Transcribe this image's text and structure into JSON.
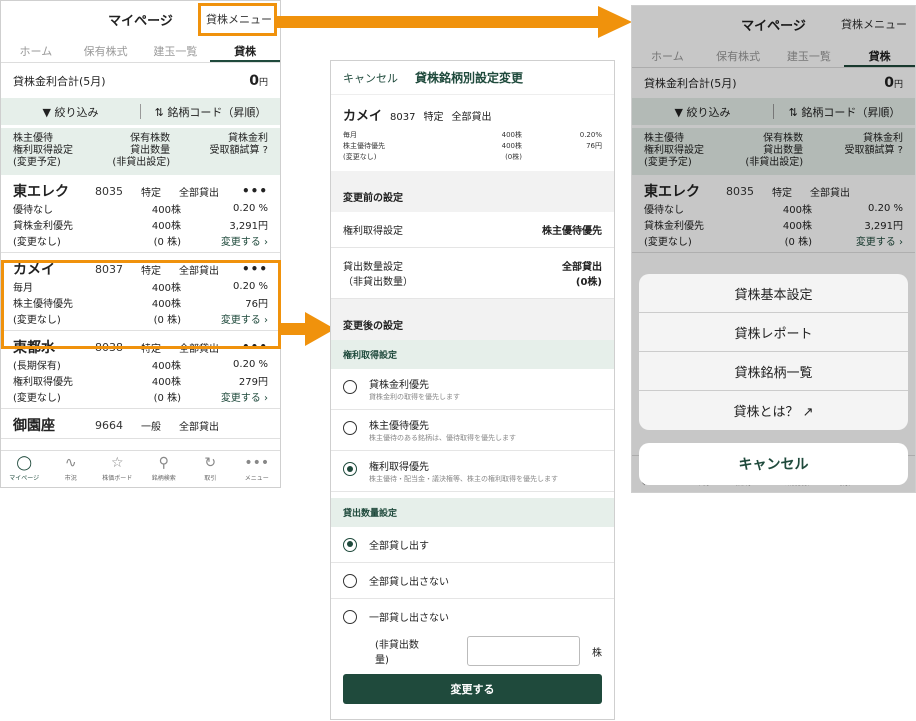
{
  "screen_left": {
    "title": "マイページ",
    "menu_label": "貸株メニュー",
    "tabs": [
      {
        "label": "ホーム",
        "active": false
      },
      {
        "label": "保有株式",
        "active": false
      },
      {
        "label": "建玉一覧",
        "active": false
      },
      {
        "label": "貸株",
        "active": true
      }
    ],
    "total_label": "貸株金利合計(5月)",
    "total_value": "0",
    "total_unit": "円",
    "filter_label": "絞り込み",
    "sort_label": "銘柄コード（昇順）",
    "col1": [
      "株主優待",
      "権利取得設定",
      "(変更予定)"
    ],
    "col2": [
      "保有株数",
      "貸出数量",
      "(非貸出設定)"
    ],
    "col3": [
      "貸株金利",
      "受取額試算 ?"
    ],
    "stocks": [
      {
        "name": "東エレク",
        "code": "8035",
        "type": "特定",
        "lend": "全部貸出",
        "r1a": "優待なし",
        "r1b": "400株",
        "r1c": "0.20 %",
        "r2a": "貸株金利優先",
        "r2b": "400株",
        "r2c": "3,291円",
        "r3a": "(変更なし)",
        "r3b": "(0 株)",
        "r3c": "変更する ›"
      },
      {
        "name": "カメイ",
        "code": "8037",
        "type": "特定",
        "lend": "全部貸出",
        "r1a": "毎月",
        "r1b": "400株",
        "r1c": "0.20 %",
        "r2a": "株主優待優先",
        "r2b": "400株",
        "r2c": "76円",
        "r3a": "(変更なし)",
        "r3b": "(0 株)",
        "r3c": "変更する ›"
      },
      {
        "name": "東都水",
        "code": "8038",
        "type": "特定",
        "lend": "全部貸出",
        "r1a": "(長期保有)",
        "r1b": "400株",
        "r1c": "0.20 %",
        "r2a": "権利取得優先",
        "r2b": "400株",
        "r2c": "279円",
        "r3a": "(変更なし)",
        "r3b": "(0 株)",
        "r3c": "変更する ›"
      },
      {
        "name": "御園座",
        "code": "9664",
        "type": "一般",
        "lend": "全部貸出"
      }
    ],
    "nav": [
      {
        "label": "マイページ",
        "icon": "person-icon"
      },
      {
        "label": "市況",
        "icon": "market-icon"
      },
      {
        "label": "株価ボード",
        "icon": "star-icon"
      },
      {
        "label": "銘柄検索",
        "icon": "search-icon"
      },
      {
        "label": "取引",
        "icon": "trade-icon"
      },
      {
        "label": "メニュー",
        "icon": "more-icon"
      }
    ]
  },
  "screen_middle": {
    "cancel": "キャンセル",
    "title": "貸株銘柄別設定変更",
    "stock_name": "カメイ",
    "stock_code": "8037",
    "stock_type": "特定",
    "stock_lend": "全部貸出",
    "mini_rows": [
      [
        "毎月",
        "400株",
        "0.20%"
      ],
      [
        "株主優待優先",
        "400株",
        "76円"
      ],
      [
        "(変更なし)",
        "(0株)",
        ""
      ]
    ],
    "before_header": "変更前の設定",
    "before_rights_label": "権利取得設定",
    "before_rights_value": "株主優待優先",
    "before_lend_label": "貸出数量設定",
    "before_lend_sub": "（非貸出数量）",
    "before_lend_value": "全部貸出",
    "before_lend_value2": "(0株)",
    "after_header": "変更後の設定",
    "rights_header": "権利取得設定",
    "rights_options": [
      {
        "label": "貸株金利優先",
        "desc": "貸株金利の取得を優先します",
        "selected": false
      },
      {
        "label": "株主優待優先",
        "desc": "株主優待のある銘柄は、優待取得を優先します",
        "selected": false
      },
      {
        "label": "権利取得優先",
        "desc": "株主優待・配当金・議決権等、株主の権利取得を優先します",
        "selected": true
      }
    ],
    "lend_header": "貸出数量設定",
    "lend_options": [
      {
        "label": "全部貸し出す",
        "selected": true
      },
      {
        "label": "全部貸し出さない",
        "selected": false
      },
      {
        "label": "一部貸し出さない",
        "selected": false
      }
    ],
    "partial_label": "(非貸出数量)",
    "partial_unit": "株",
    "submit": "変更する"
  },
  "screen_right": {
    "title": "マイページ",
    "menu_label": "貸株メニュー",
    "sheet_items": [
      "貸株基本設定",
      "貸株レポート",
      "貸株銘柄一覧",
      "貸株とは？ ↗"
    ],
    "cancel": "キャンセル"
  },
  "colors": {
    "accent": "#1f4a3c",
    "highlight": "#f0920c",
    "section_bg": "#e6efea"
  }
}
